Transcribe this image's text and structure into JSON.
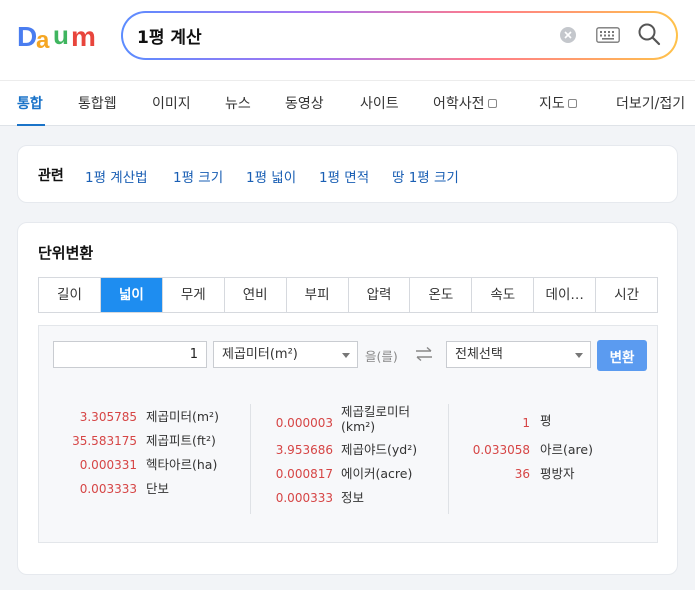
{
  "search": {
    "query": "1평 계산"
  },
  "nav": {
    "items": [
      {
        "label": "통합",
        "active": true
      },
      {
        "label": "통합웹"
      },
      {
        "label": "이미지"
      },
      {
        "label": "뉴스"
      },
      {
        "label": "동영상"
      },
      {
        "label": "사이트"
      },
      {
        "label": "어학사전",
        "external": true
      },
      {
        "label": "지도",
        "external": true
      },
      {
        "label": "더보기/접기"
      }
    ]
  },
  "related": {
    "title": "관련",
    "links": [
      "1평 계산법",
      "1평 크기",
      "1평 넓이",
      "1평 면적",
      "땅 1평 크기"
    ]
  },
  "unit_converter": {
    "title": "단위변환",
    "tabs": [
      "길이",
      "넓이",
      "무게",
      "연비",
      "부피",
      "압력",
      "온도",
      "속도",
      "데이…",
      "시간"
    ],
    "active_tab": "넓이",
    "input_value": "1",
    "from_unit": "제곱미터(m²)",
    "eul_label": "을(를)",
    "to_unit": "전체선택",
    "convert_label": "변환",
    "results": {
      "col1": [
        {
          "value": "3.305785",
          "unit": "제곱미터(m²)"
        },
        {
          "value": "35.583175",
          "unit": "제곱피트(ft²)"
        },
        {
          "value": "0.000331",
          "unit": "헥타아르(ha)"
        },
        {
          "value": "0.003333",
          "unit": "단보"
        }
      ],
      "col2": [
        {
          "value": "0.000003",
          "unit": "제곱킬로미터 (km²)"
        },
        {
          "value": "3.953686",
          "unit": "제곱야드(yd²)"
        },
        {
          "value": "0.000817",
          "unit": "에이커(acre)"
        },
        {
          "value": "0.000333",
          "unit": "정보"
        }
      ],
      "col3": [
        {
          "value": "1",
          "unit": "평"
        },
        {
          "value": "0.033058",
          "unit": "아르(are)"
        },
        {
          "value": "36",
          "unit": "평방자"
        }
      ]
    }
  },
  "colors": {
    "accent": "#1e8df0",
    "link": "#1a5fb4",
    "value": "#d64545",
    "button": "#5b9bf0"
  }
}
